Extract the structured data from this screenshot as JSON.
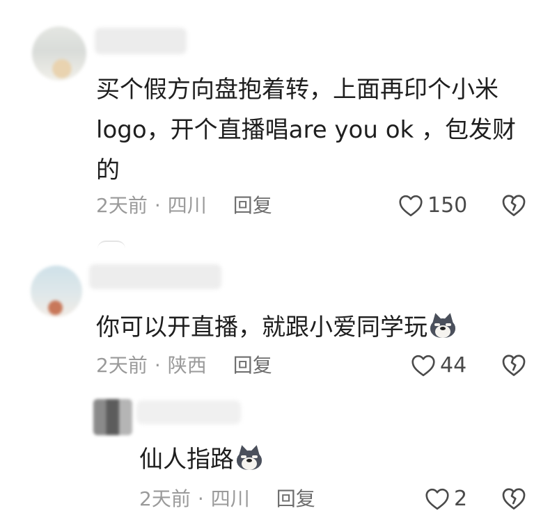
{
  "comments": [
    {
      "text": "买个假方向盘抱着转，上面再印个小米logo，开个直播唱are you ok ，包发财的",
      "time": "2天前",
      "separator": "·",
      "location": "四川",
      "reply_label": "回复",
      "likes": "150"
    },
    {
      "text": "你可以开直播，就跟小爱同学玩",
      "emoji": "wolf-emoji",
      "time": "2天前",
      "separator": "·",
      "location": "陕西",
      "reply_label": "回复",
      "likes": "44"
    },
    {
      "text": "仙人指路",
      "emoji": "wolf-emoji",
      "time": "2天前",
      "separator": "·",
      "location": "四川",
      "reply_label": "回复",
      "likes": "2",
      "is_reply": true
    }
  ],
  "icons": {
    "like": "heart-outline-icon",
    "dislike": "broken-heart-icon"
  },
  "colors": {
    "text": "#1e1e1e",
    "meta": "#9a9a9a",
    "reply": "#6d6d6d",
    "icon": "#4a4a4a"
  }
}
